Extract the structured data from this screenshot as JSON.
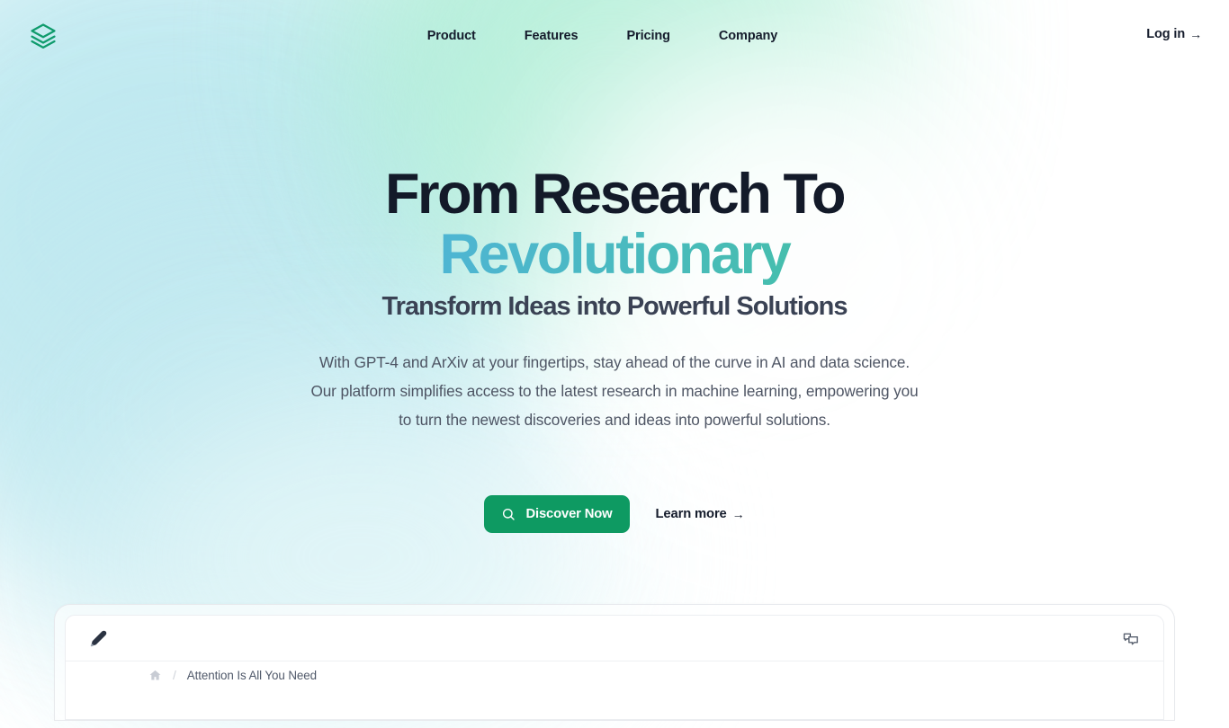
{
  "brand": {
    "logo_icon": "layers-stack-icon",
    "accent_green": "#0e9a62",
    "accent_gradient_from": "#4aa3e8",
    "accent_gradient_to": "#38bf8e"
  },
  "nav": {
    "items": [
      {
        "label": "Product"
      },
      {
        "label": "Features"
      },
      {
        "label": "Pricing"
      },
      {
        "label": "Company"
      }
    ],
    "login": {
      "label": "Log in",
      "arrow": "→"
    }
  },
  "hero": {
    "title_line1": "From Research To",
    "title_line2": "Revolutionary",
    "subtitle": "Transform Ideas into Powerful Solutions",
    "body": "With GPT-4 and ArXiv at your fingertips, stay ahead of the curve in AI and data science. Our platform simplifies access to the latest research in machine learning, empowering you to turn the newest discoveries and ideas into powerful solutions.",
    "primary_cta": {
      "label": "Discover Now",
      "icon": "search-icon"
    },
    "secondary_cta": {
      "label": "Learn more",
      "arrow": "→"
    }
  },
  "preview": {
    "toolbar": {
      "edit_icon": "pen-icon",
      "chat_icon": "chat-bubbles-icon"
    },
    "breadcrumb": {
      "home_icon": "home-icon",
      "separator": "/",
      "title": "Attention Is All You Need"
    }
  }
}
